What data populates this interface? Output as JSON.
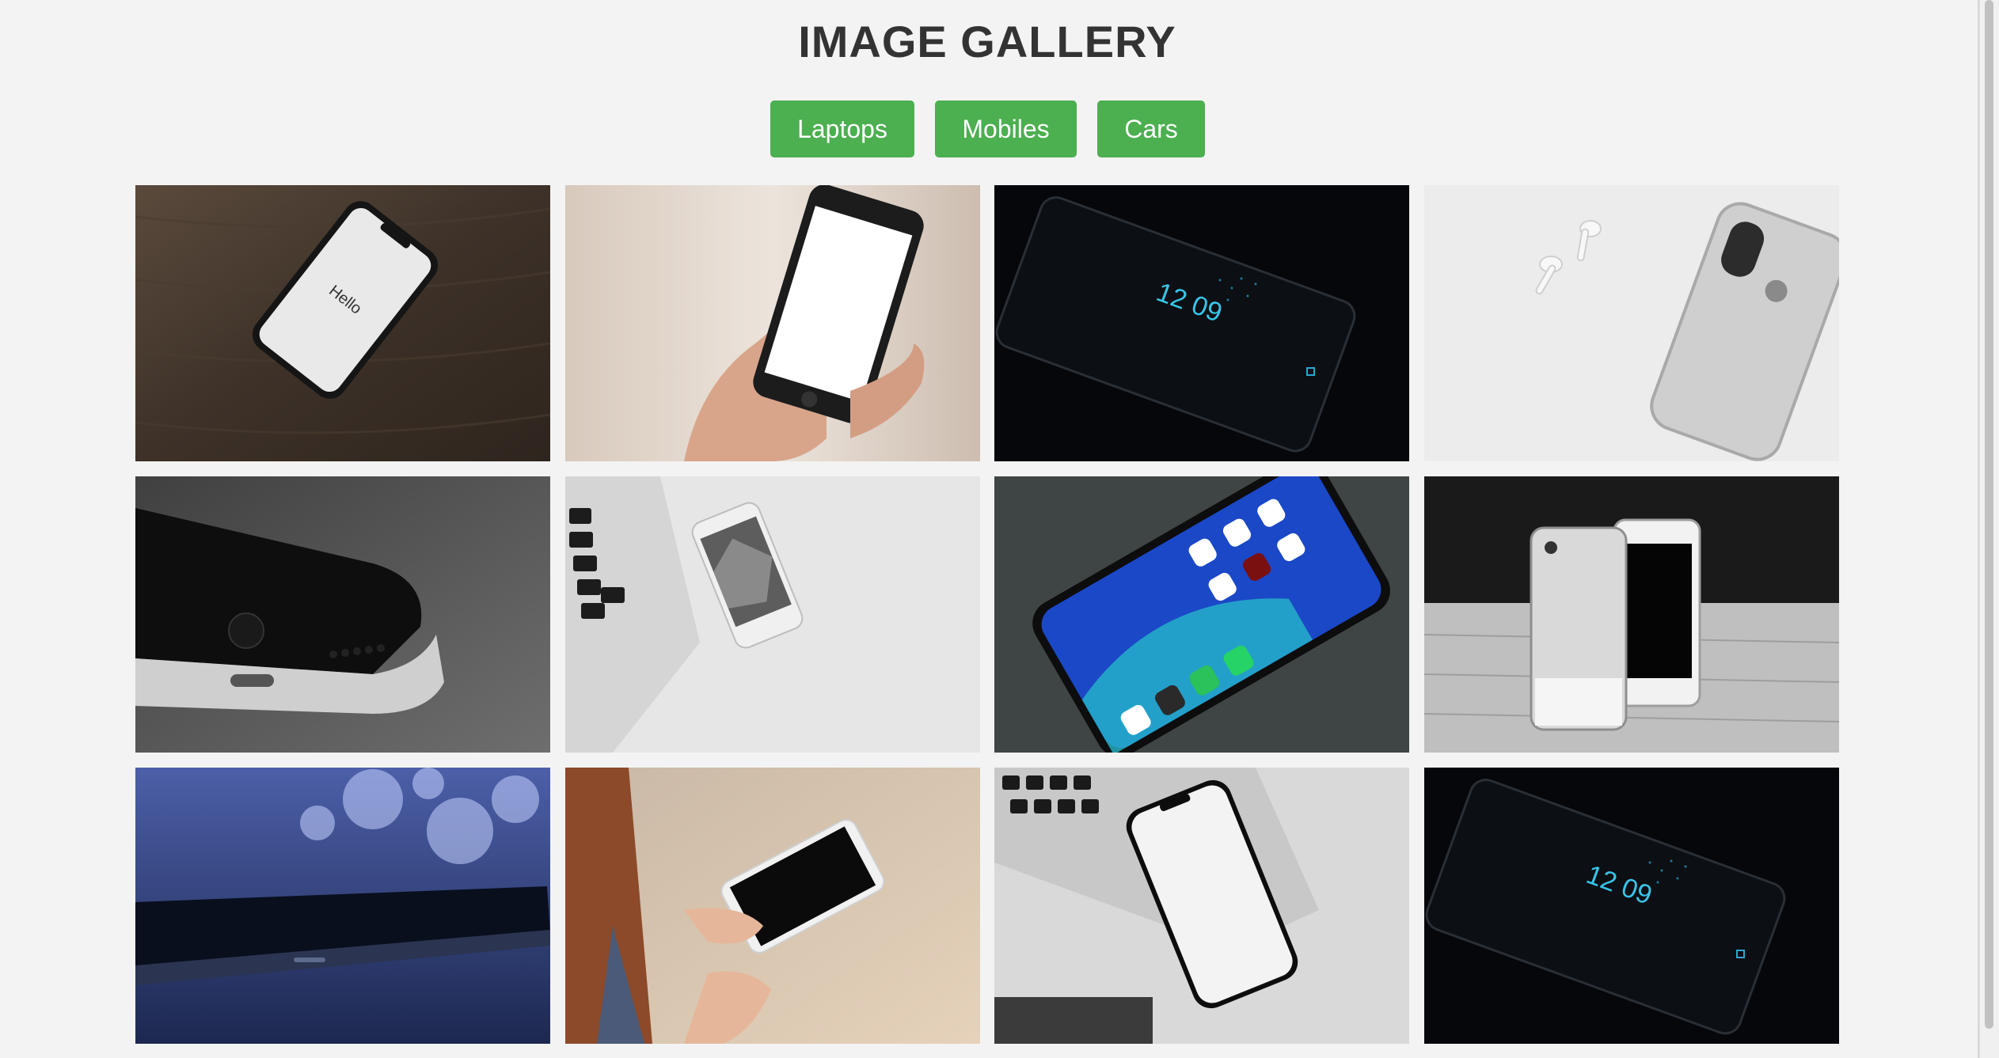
{
  "page": {
    "title": "IMAGE GALLERY"
  },
  "filters": [
    {
      "label": "Laptops"
    },
    {
      "label": "Mobiles"
    },
    {
      "label": "Cars"
    }
  ],
  "colors": {
    "accent": "#4caf50",
    "background": "#f3f3f3",
    "title": "#333333"
  },
  "gallery": {
    "selected_category": "Mobiles",
    "tile_1_screen_text": "Hello",
    "tile_3_clock": "12\n09",
    "tile_12_clock": "12\n09"
  }
}
